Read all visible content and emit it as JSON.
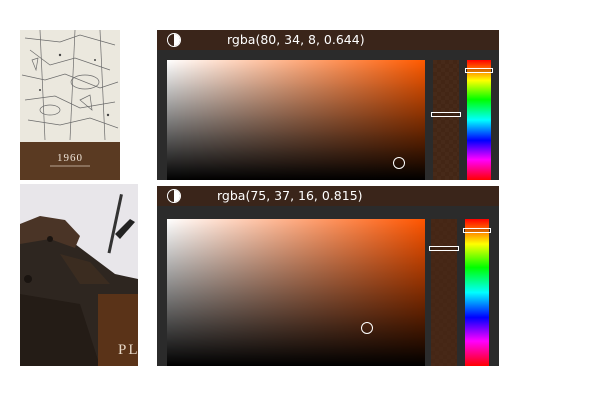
{
  "thumbnails": [
    {
      "name": "map-1960-thumbnail",
      "caption": "1960"
    },
    {
      "name": "shipwreck-thumbnail",
      "caption": "PL"
    }
  ],
  "pickers": [
    {
      "value_text": "rgba(80, 34, 8, 0.644)",
      "hue_color": "#ff5a00",
      "alpha": 0.644,
      "alpha_color": "#502208",
      "hue_level": 0.06
    },
    {
      "value_text": "rgba(75, 37, 16, 0.815)",
      "hue_color": "#ff5500",
      "alpha": 0.815,
      "alpha_color": "#4b2510",
      "hue_level": 0.06
    }
  ],
  "icons": {
    "toggle": "contrast-icon"
  }
}
